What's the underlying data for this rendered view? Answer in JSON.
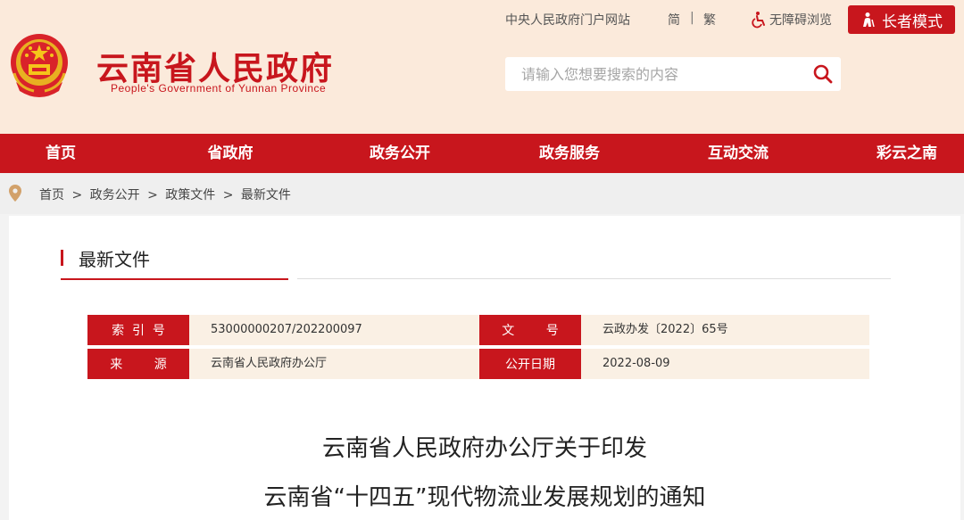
{
  "header": {
    "title": "云南省人民政府",
    "subtitle": "People's Government of Yunnan Province",
    "portal_link": "中央人民政府门户网站",
    "lang_simplified": "简",
    "lang_separator": "|",
    "lang_traditional": "繁",
    "accessibility": "无障碍浏览",
    "elder_mode": "长者模式",
    "search": {
      "placeholder": "请输入您想要搜索的内容"
    }
  },
  "nav": {
    "items": [
      {
        "label": "首页"
      },
      {
        "label": "省政府"
      },
      {
        "label": "政务公开"
      },
      {
        "label": "政务服务"
      },
      {
        "label": "互动交流"
      },
      {
        "label": "彩云之南"
      }
    ]
  },
  "breadcrumb": {
    "items": [
      "首页",
      "政务公开",
      "政策文件",
      "最新文件"
    ],
    "separator": ">"
  },
  "section": {
    "title": "最新文件"
  },
  "meta": {
    "index_label": "索  引  号",
    "index_value": "53000000207/202200097",
    "docno_label": "文        号",
    "docno_value": "云政办发〔2022〕65号",
    "source_label": "来        源",
    "source_value": "云南省人民政府办公厅",
    "date_label": "公开日期",
    "date_value": "2022-08-09"
  },
  "document": {
    "title_line1": "云南省人民政府办公厅关于印发",
    "title_line2": "云南省“十四五”现代物流业发展规划的通知"
  },
  "colors": {
    "brand_red": "#c8161d",
    "header_bg": "#fbeadb",
    "meta_bg": "#faf0e4"
  },
  "icons": [
    "national-emblem",
    "accessibility-icon",
    "elder-icon",
    "search-icon",
    "location-pin-icon"
  ]
}
